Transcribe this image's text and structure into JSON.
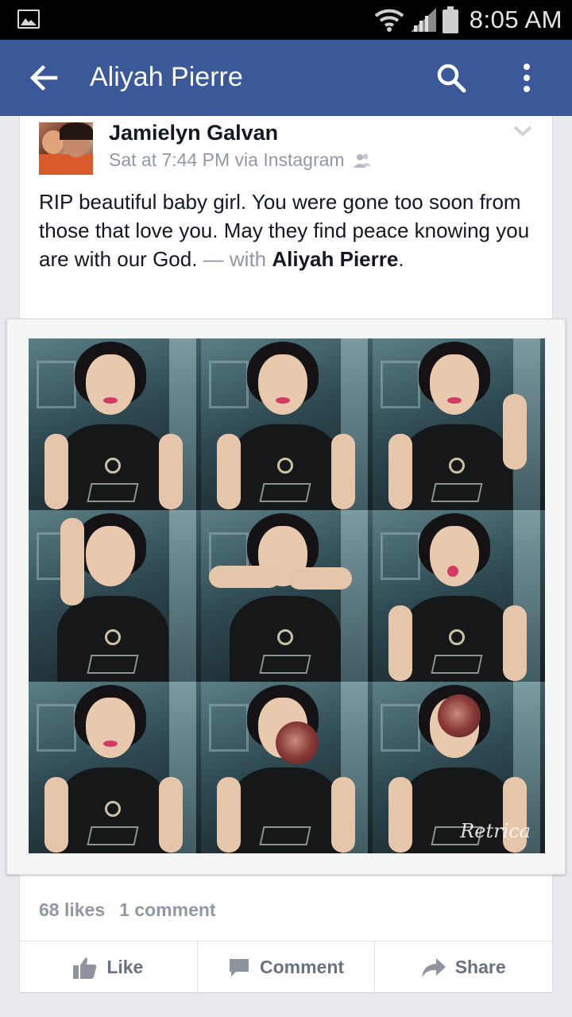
{
  "status_bar": {
    "time": "8:05 AM",
    "icons": [
      "gallery-icon",
      "wifi-icon",
      "signal-icon",
      "battery-icon"
    ]
  },
  "app_bar": {
    "title": "Aliyah Pierre",
    "icons": [
      "back-arrow-icon",
      "search-icon",
      "more-vertical-icon"
    ],
    "color": "#3b5998"
  },
  "post": {
    "author": "Jamielyn Galvan",
    "meta": "Sat at 7:44 PM via Instagram",
    "privacy_icon": "friends-icon",
    "text": "RIP beautiful baby girl. You were gone too soon from those that love you. May they find peace knowing you are with our God.",
    "with_label": " — with ",
    "tagged": "Aliyah Pierre",
    "period": ".",
    "photo_watermark": "Retrica",
    "likes": "68 likes",
    "comments": "1 comment",
    "actions": [
      {
        "label": "Like",
        "icon": "thumbs-up-icon"
      },
      {
        "label": "Comment",
        "icon": "comment-icon"
      },
      {
        "label": "Share",
        "icon": "share-arrow-icon"
      }
    ]
  }
}
